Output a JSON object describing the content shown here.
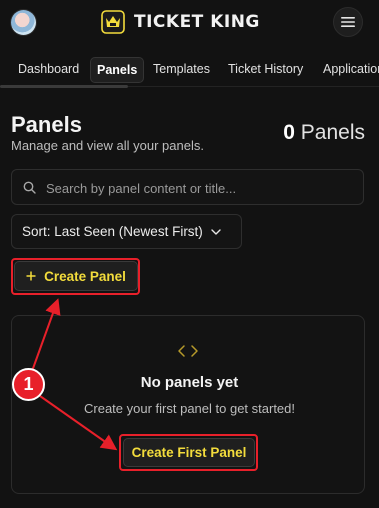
{
  "brand": {
    "name": "TICKET KING",
    "logo_icon": "ticket-king-logo-icon",
    "accent": "#f3dc3c"
  },
  "header": {
    "avatar_icon": "user-avatar-icon",
    "menu_icon": "hamburger-menu-icon"
  },
  "tabs": [
    {
      "label": "Dashboard",
      "active": false
    },
    {
      "label": "Panels",
      "active": true
    },
    {
      "label": "Templates",
      "active": false
    },
    {
      "label": "Ticket History",
      "active": false
    },
    {
      "label": "Applications",
      "active": false
    }
  ],
  "page": {
    "title": "Panels",
    "subtitle": "Manage and view all your panels.",
    "count_number": "0",
    "count_label": "Panels"
  },
  "search": {
    "placeholder": "Search by panel content or title...",
    "value": "",
    "icon": "search-icon"
  },
  "sort": {
    "label": "Sort: Last Seen (Newest First)",
    "icon": "chevron-down-icon"
  },
  "create_button": {
    "label": "Create Panel",
    "icon": "plus-icon"
  },
  "empty_state": {
    "icon": "code-brackets-icon",
    "title": "No panels yet",
    "subtitle": "Create your first panel to get started!",
    "button_label": "Create First Panel"
  },
  "annotation": {
    "step_number": "1",
    "color": "#e8202a"
  }
}
